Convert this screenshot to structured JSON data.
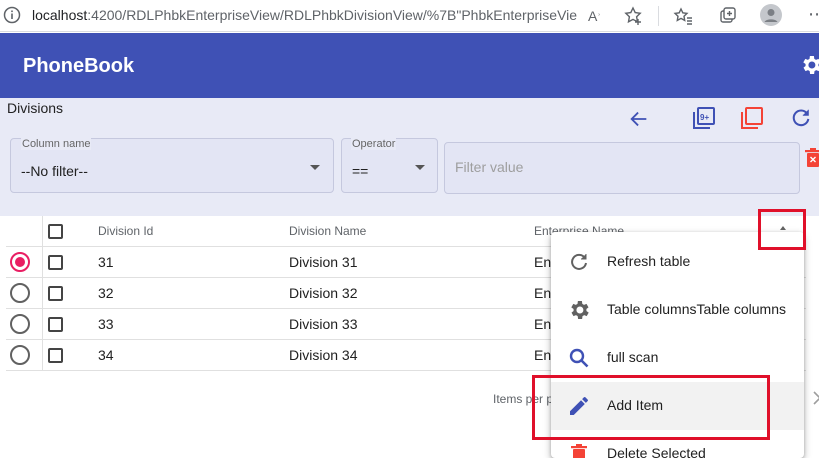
{
  "browser": {
    "url_host": "localhost",
    "url_path": ":4200/RDLPhbkEnterpriseView/RDLPhbkDivisionView/%7B\"PhbkEnterpriseVie..."
  },
  "app": {
    "title": "PhoneBook"
  },
  "panel": {
    "title": "Divisions",
    "column_field": {
      "label": "Column name",
      "value": "--No filter--"
    },
    "operator_field": {
      "label": "Operator",
      "value": "=="
    },
    "filter_value": {
      "placeholder": "Filter value"
    }
  },
  "table": {
    "headers": [
      "Division Id",
      "Division Name",
      "Enterprise Name"
    ],
    "rows": [
      {
        "id": "31",
        "name": "Division 31",
        "enterprise": "Ent",
        "selected": true
      },
      {
        "id": "32",
        "name": "Division 32",
        "enterprise": "Ent",
        "selected": false
      },
      {
        "id": "33",
        "name": "Division 33",
        "enterprise": "Ent",
        "selected": false
      },
      {
        "id": "34",
        "name": "Division 34",
        "enterprise": "Ent",
        "selected": false
      }
    ],
    "paginator_label": "Items per p"
  },
  "menu": {
    "items": [
      {
        "label": "Refresh table",
        "icon": "refresh-icon"
      },
      {
        "label": "Table columnsTable columns",
        "icon": "gear-icon"
      },
      {
        "label": "full scan",
        "icon": "search-icon"
      },
      {
        "label": "Add Item",
        "icon": "pencil-icon"
      },
      {
        "label": "Delete Selected",
        "icon": "trash-icon"
      }
    ]
  },
  "colors": {
    "primary": "#3f51b5",
    "panel_bg": "#e8eaf6",
    "accent": "#e91e63",
    "warn": "#f44336",
    "highlight_box": "#e0102a"
  }
}
